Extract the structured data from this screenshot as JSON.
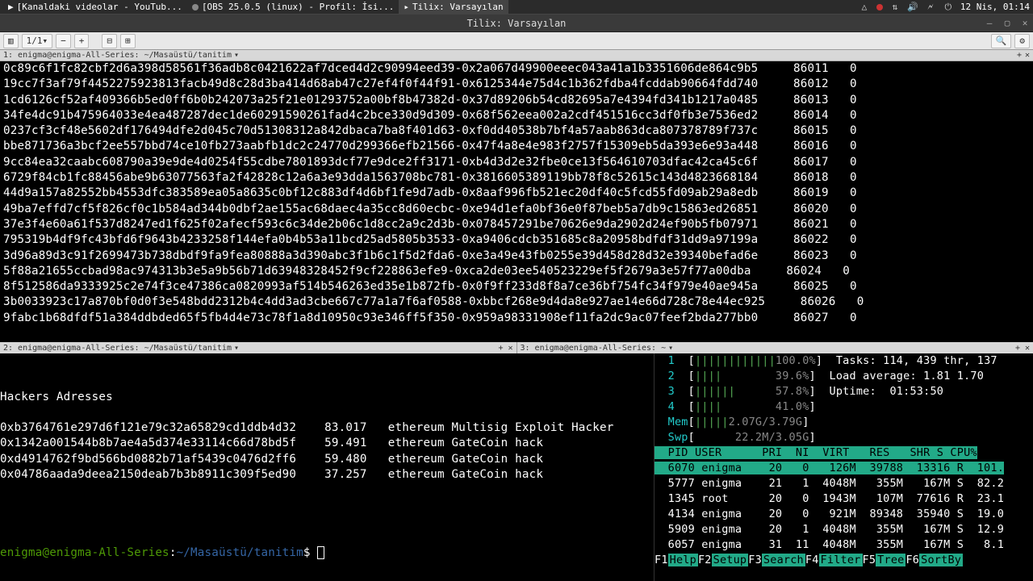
{
  "topbar": {
    "apps": [
      {
        "label": "[Kanaldaki videolar - YouTub...",
        "icon": "▶"
      },
      {
        "label": "[OBS 25.0.5 (linux) - Profil: İsi...",
        "icon": "●"
      },
      {
        "label": "Tilix: Varsayılan",
        "icon": "▸"
      }
    ],
    "time": "12 Nis, 01:14"
  },
  "tilix": {
    "title": "Tilix: Varsayılan"
  },
  "toolbar": {
    "page": "1/1",
    "plus": "+",
    "minus": "−"
  },
  "pane1": {
    "title": "1: enigma@enigma-All-Series: ~/Masaüstü/tanitim"
  },
  "pane2": {
    "title": "2: enigma@enigma-All-Series: ~/Masaüstü/tanitim"
  },
  "pane3": {
    "title": "3: enigma@enigma-All-Series: ~"
  },
  "term1_rows": [
    {
      "h": "0c89c6f1fc82cbf2d6a398d58561f36adb8c0421622af7dced4d2c90994eed39-0x2a067d49900eeec043a41a1b3351606de864c9b5",
      "n": "86011",
      "c": "0"
    },
    {
      "h": "19cc7f3af79f4452275923813facb49d8c28d3ba414d68ab47c27ef4f0f44f91-0x6125344e75d4c1b362fdba4fcddab90664fdd740",
      "n": "86012",
      "c": "0"
    },
    {
      "h": "1cd6126cf52af409366b5ed0ff6b0b242073a25f21e01293752a00bf8b47382d-0x37d89206b54cd82695a7e4394fd341b1217a0485",
      "n": "86013",
      "c": "0"
    },
    {
      "h": "34fe4dc91b475964033e4ea487287dec1de60291590261fad4c2bce330d9d309-0x68f562eea002a2cdf451516cc3df0fb3e7536ed2",
      "n": "86014",
      "c": "0"
    },
    {
      "h": "0237cf3cf48e5602df176494dfe2d045c70d51308312a842dbaca7ba8f401d63-0xf0dd40538b7bf4a57aab863dca807378789f737c",
      "n": "86015",
      "c": "0"
    },
    {
      "h": "bbe871736a3bcf2ee557bbd74ce10fb273aabfb1dc2c24770d299366efb21566-0x47f4a8e4e983f2757f15309eb5da393e6e93a448",
      "n": "86016",
      "c": "0"
    },
    {
      "h": "9cc84ea32caabc608790a39e9de4d0254f55cdbe7801893dcf77e9dce2ff3171-0xb4d3d2e32fbe0ce13f564610703dfac42ca45c6f",
      "n": "86017",
      "c": "0"
    },
    {
      "h": "6729f84cb1fc88456abe9b63077563fa2f42828c12a6a3e93dda1563708bc781-0x3816605389119bb78f8c52615c143d4823668184",
      "n": "86018",
      "c": "0"
    },
    {
      "h": "44d9a157a82552bb4553dfc383589ea05a8635c0bf12c883df4d6bf1fe9d7adb-0x8aaf996fb521ec20df40c5fcd55fd09ab29a8edb",
      "n": "86019",
      "c": "0"
    },
    {
      "h": "49ba7effd7cf5f826cf0c1b584ad344b0dbf2ae155ac68daec4a35cc8d60ecbc-0xe94d1efa0bf36e0f87beb5a7db9c15863ed26851",
      "n": "86020",
      "c": "0"
    },
    {
      "h": "37e3f4e60a61f537d8247ed1f625f02afecf593c6c34de2b06c1d8cc2a9c2d3b-0x078457291be70626e9da2902d24ef90b5fb07971",
      "n": "86021",
      "c": "0"
    },
    {
      "h": "795319b4df9fc43bfd6f9643b4233258f144efa0b4b53a11bcd25ad5805b3533-0xa9406cdcb351685c8a20958bdfdf31dd9a97199a",
      "n": "86022",
      "c": "0"
    },
    {
      "h": "3d96a89d3c91f2699473b738dbdf9fa9fea80888a3d390abc3f1b6c1f5d2fda6-0xe3a49e43fb0255e39d458d28d32e39340befad6e",
      "n": "86023",
      "c": "0"
    },
    {
      "h": "5f88a21655ccbad98ac974313b3e5a9b56b71d63948328452f9cf228863efe9-0xca2de03ee540523229ef5f2679a3e57f77a00dba",
      "n": "86024",
      "c": "0"
    },
    {
      "h": "8f512586da9333925c2e74f3ce47386ca0820993af514b546263ed35e1b872fb-0x0f9ff233d8f8a7ce36bf754fc34f979e40ae945a",
      "n": "86025",
      "c": "0"
    },
    {
      "h": "3b0033923c17a870bf0d0f3e548bdd2312b4c4dd3ad3cbe667c77a1a7f6af0588-0xbbcf268e9d4da8e927ae14e66d728c78e44ec925",
      "n": "86026",
      "c": "0"
    },
    {
      "h": "9fabc1b68dfdf51a384ddbded65f5fb4d4e73c78f1a8d10950c93e346ff5f350-0x959a98331908ef11fa2dc9ac07feef2bda277bb0",
      "n": "86027",
      "c": "0"
    }
  ],
  "hackers": {
    "title": "Hackers Adresses",
    "rows": [
      {
        "addr": "0xb3764761e297d6f121e79c32a65829cd1ddb4d32",
        "amt": "83.017",
        "desc": "ethereum Multisig Exploit Hacker"
      },
      {
        "addr": "0x1342a001544b8b7ae4a5d374e33114c66d78bd5f",
        "amt": "59.491",
        "desc": "ethereum GateCoin hack"
      },
      {
        "addr": "0xd4914762f9bd566bd0882b71af5439c0476d2ff6",
        "amt": "59.480",
        "desc": "ethereum GateCoin hack"
      },
      {
        "addr": "0x04786aada9deea2150deab7b3b8911c309f5ed90",
        "amt": "37.257",
        "desc": "ethereum GateCoin hack"
      }
    ]
  },
  "prompt": {
    "user": "enigma@enigma-All-Series",
    "path": "~/Masaüstü/tanitim",
    "sym": "$"
  },
  "htop": {
    "cpus": [
      {
        "n": "1",
        "bar": "||||||||||||",
        "pct": "100.0%"
      },
      {
        "n": "2",
        "bar": "||||       ",
        "pct": "39.6%"
      },
      {
        "n": "3",
        "bar": "||||||     ",
        "pct": "57.8%"
      },
      {
        "n": "4",
        "bar": "||||       ",
        "pct": "41.0%"
      }
    ],
    "mem": {
      "label": "Mem",
      "bar": "|||||",
      "val": "2.07G/3.79G"
    },
    "swp": {
      "label": "Swp",
      "bar": "",
      "val": "22.2M/3.05G"
    },
    "tasks": "Tasks: 114, 439 thr, 137",
    "load": "Load average: 1.81 1.70",
    "uptime": "Uptime:  01:53:50",
    "head": "  PID USER      PRI  NI  VIRT   RES   SHR S CPU%",
    "rows": [
      {
        "pid": "6070",
        "user": "enigma",
        "pri": "20",
        "ni": "0",
        "virt": "126M",
        "res": "39788",
        "shr": "13316",
        "s": "R",
        "cpu": "101."
      },
      {
        "pid": "5777",
        "user": "enigma",
        "pri": "21",
        "ni": "1",
        "virt": "4048M",
        "res": "355M",
        "shr": "167M",
        "s": "S",
        "cpu": "82.2"
      },
      {
        "pid": "1345",
        "user": "root",
        "pri": "20",
        "ni": "0",
        "virt": "1943M",
        "res": "107M",
        "shr": "77616",
        "s": "R",
        "cpu": "23.1"
      },
      {
        "pid": "4134",
        "user": "enigma",
        "pri": "20",
        "ni": "0",
        "virt": "921M",
        "res": "89348",
        "shr": "35940",
        "s": "S",
        "cpu": "19.0"
      },
      {
        "pid": "5909",
        "user": "enigma",
        "pri": "20",
        "ni": "1",
        "virt": "4048M",
        "res": "355M",
        "shr": "167M",
        "s": "S",
        "cpu": "12.9"
      },
      {
        "pid": "6057",
        "user": "enigma",
        "pri": "31",
        "ni": "11",
        "virt": "4048M",
        "res": "355M",
        "shr": "167M",
        "s": "S",
        "cpu": "8.1"
      }
    ],
    "fkeys": [
      [
        "F1",
        "Help"
      ],
      [
        "F2",
        "Setup"
      ],
      [
        "F3",
        "Search"
      ],
      [
        "F4",
        "Filter"
      ],
      [
        "F5",
        "Tree"
      ],
      [
        "F6",
        "SortBy"
      ]
    ]
  }
}
